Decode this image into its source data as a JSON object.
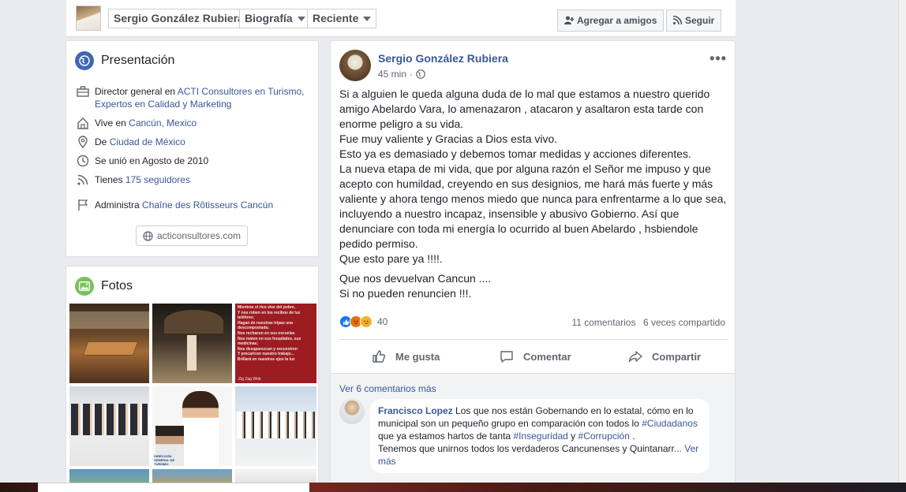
{
  "header": {
    "profile_name": "Sergio González Rubiera",
    "tab_bio": "Biografía",
    "tab_recent": "Reciente",
    "add_friends": "Agregar a amigos",
    "follow": "Seguir"
  },
  "intro": {
    "title": "Presentación",
    "work_prefix": "Director general en ",
    "work_link": "ACTI Consultores en Turismo, Expertos en Calidad y Marketing",
    "lives_prefix": "Vive en ",
    "lives_link": "Cancún, Mexico",
    "from_prefix": "De ",
    "from_link": "Ciudad de México",
    "joined": "Se unió en Agosto de 2010",
    "followers_prefix": "Tienes ",
    "followers_link": "175 seguidores",
    "manages_prefix": "Administra ",
    "manages_link": "Chaîne des Rôtisseurs Cancún",
    "website": "acticonsultores.com"
  },
  "photos": {
    "title": "Fotos",
    "items": [
      {
        "label": "restaurant-table"
      },
      {
        "label": "outdoor-terrace"
      },
      {
        "label": "text-post-red",
        "lines": [
          "Mientras el rico vive del pobre,",
          "Y nos roben en los recibos de luz",
          "teléfono;",
          "Hagan de nuestras tripas una",
          "descompostada;",
          "Nos rechacen en sus escuelas",
          "Nos maten en sus hospitales, sus",
          "medicinas;",
          "Nos desaparezcan y secuestren",
          "Y precaricen nuestro trabajo...",
          "Brillará en nuestros ojos la luz"
        ],
        "footer": "Zig Zag Web"
      },
      {
        "label": "group-photo"
      },
      {
        "label": "tourism-event",
        "caption": "DIRECCIÓN GENERAL DE TURISMO"
      },
      {
        "label": "event-stage"
      },
      {
        "label": "outdoor-sky"
      },
      {
        "label": "banner-photo"
      },
      {
        "label": "graphic-photo"
      }
    ]
  },
  "post": {
    "author": "Sergio González Rubiera",
    "time": "45 min",
    "paragraph1": [
      "Si a alguien le queda alguna duda de lo mal que estamos a nuestro querido amigo Abelardo Vara, lo amenazaron , atacaron y asaltaron esta tarde con enorme peligro a su vida.",
      "Fue muy valiente y Gracias a Dios esta vivo.",
      "Esto ya es demasiado y debemos tomar medidas y acciones diferentes.",
      "La nueva etapa de mi vida, que por alguna razón el Señor me impuso y que acepto con humildad, creyendo en sus designios, me hará más fuerte y más valiente y ahora tengo menos miedo que nunca para enfrentarme a lo que sea, incluyendo a nuestro incapaz, insensible y abusivo Gobierno. Así que denunciare con toda mi energía lo ocurrido al buen Abelardo , hsbiendole pedido permiso.",
      "Que esto pare ya !!!!."
    ],
    "paragraph2": [
      "Que nos devuelvan Cancun ....",
      "Si no pueden renuncien !!!."
    ],
    "reaction_count": "40",
    "comments_count": "11 comentarios",
    "shares_count": "6 veces compartido",
    "like_label": "Me gusta",
    "comment_label": "Comentar",
    "share_label": "Compartir",
    "view_more_comments": "Ver 6 comentarios más"
  },
  "comment": {
    "author": "Francisco Lopez",
    "text1": "Los que nos están Gobernando en lo estatal, cómo en lo municipal son un pequeño grupo en comparación con todos lo ",
    "tag1": "#Ciudadanos",
    "text2": " que ya estamos hartos de tanta ",
    "tag2": "#Inseguridad",
    "text3": " y ",
    "tag3": "#Corrupción",
    "text4": " .",
    "text5": "Tenemos que unirnos todos los verdaderos Cancunenses y Quintanarr",
    "ellipsis": "...",
    "see_more": "Ver más"
  },
  "colors": {
    "link": "#385898",
    "bg": "#e9ebee",
    "intro_icon": "#4267b2",
    "photos_icon": "#7cc15e"
  }
}
